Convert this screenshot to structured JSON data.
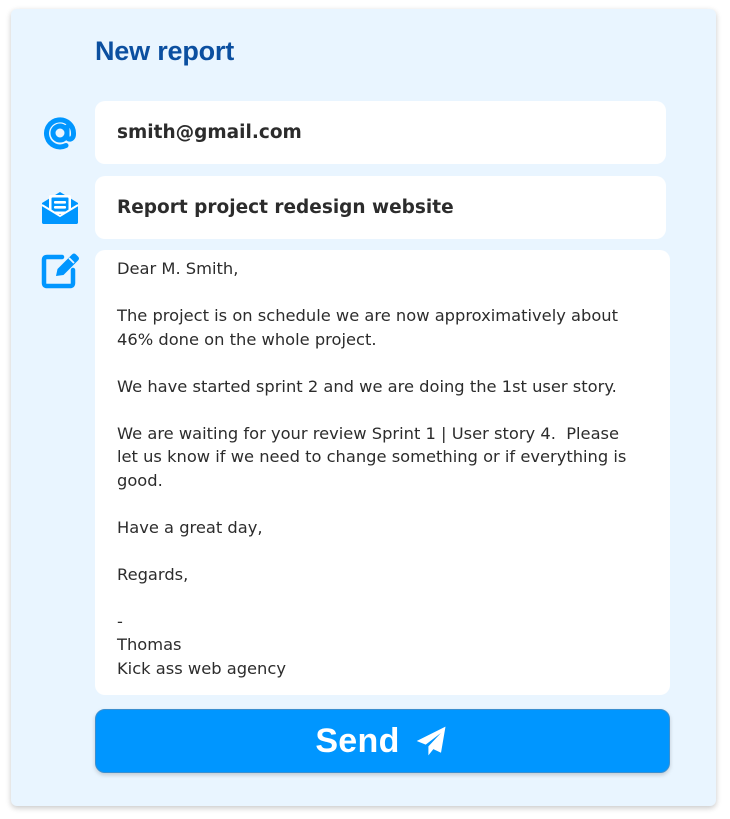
{
  "form": {
    "title": "New report",
    "to": "smith@gmail.com",
    "subject": "Report project redesign website",
    "message": "Dear M. Smith,\n\nThe project is on schedule we are now approximatively about\n46% done on the whole project.\n\nWe have started sprint 2 and we are doing the 1st user story.\n\nWe are waiting for your review Sprint 1 | User story 4.  Please\nlet us know if we need to change something or if everything is\ngood.\n\nHave a great day,\n\nRegards,\n\n-\nThomas\nKick ass web agency",
    "send_label": "Send"
  },
  "icons": {
    "to": "at-sign-icon",
    "subject": "envelope-open-text-icon",
    "message": "edit-pencil-icon",
    "send": "paper-plane-icon"
  },
  "colors": {
    "card_background": "#e9f5ff",
    "title": "#0b4fa0",
    "accent": "#0096ff",
    "field_background": "#ffffff",
    "text": "#2c2c2c"
  }
}
